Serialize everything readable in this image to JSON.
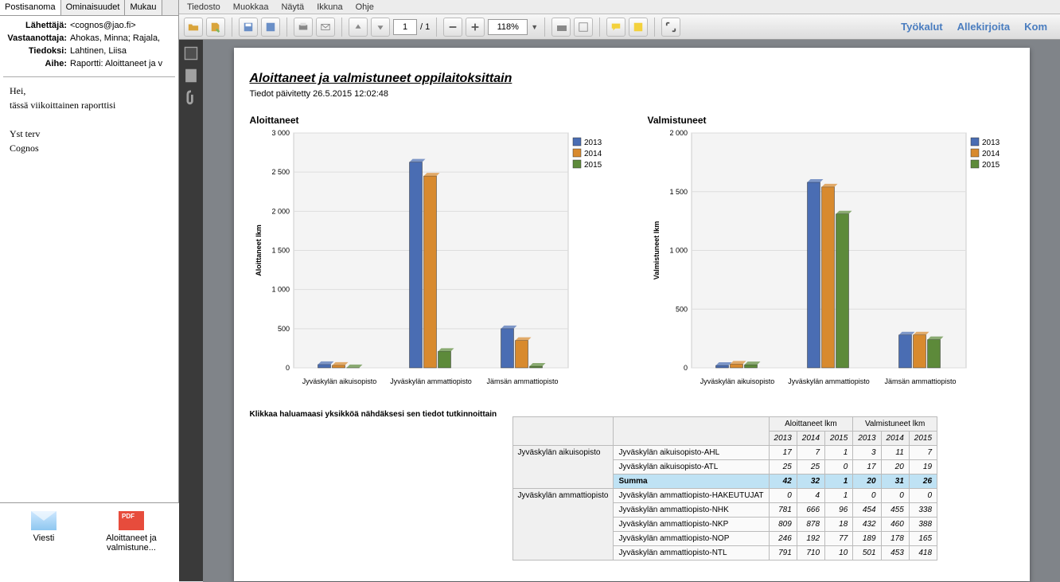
{
  "email": {
    "tabs": [
      "Postisanoma",
      "Ominaisuudet",
      "Mukau"
    ],
    "from_lbl": "Lähettäjä:",
    "from_val": "<cognos@jao.fi>",
    "to_lbl": "Vastaanottaja:",
    "to_val": "Ahokas, Minna; Rajala,",
    "cc_lbl": "Tiedoksi:",
    "cc_val": "Lahtinen, Liisa",
    "subj_lbl": "Aihe:",
    "subj_val": "Raportti: Aloittaneet ja v",
    "body_l1": "Hei,",
    "body_l2": "tässä viikoittainen raporttisi",
    "body_l3": "Yst terv",
    "body_l4": "Cognos",
    "att1": "Viesti",
    "att2": "Aloittaneet ja valmistune..."
  },
  "menubar": [
    "Tiedosto",
    "Muokkaa",
    "Näytä",
    "Ikkuna",
    "Ohje"
  ],
  "toolbar": {
    "page_cur": "1",
    "page_sep": "/ 1",
    "zoom": "118%",
    "right": [
      "Työkalut",
      "Allekirjoita",
      "Kom"
    ]
  },
  "report": {
    "title": "Aloittaneet ja valmistuneet oppilaitoksittain",
    "subtitle": "Tiedot päivitetty 26.5.2015 12:02:48",
    "legend": [
      "2013",
      "2014",
      "2015"
    ],
    "colors": [
      "#4a6db3",
      "#d88a2e",
      "#5d8a3a"
    ],
    "chart1_head": "Aloittaneet",
    "chart2_head": "Valmistuneet",
    "table_caption": "Klikkaa haluamaasi yksikköä nähdäksesi sen tiedot tutkinnoittain",
    "col_grp1": "Aloittaneet lkm",
    "col_grp2": "Valmistuneet lkm",
    "years": [
      "2013",
      "2014",
      "2015"
    ],
    "groups": [
      {
        "name": "Jyväskylän aikuisopisto",
        "rows": [
          {
            "name": "Jyväskylän aikuisopisto-AHL",
            "v": [
              17,
              7,
              1,
              3,
              11,
              7
            ]
          },
          {
            "name": "Jyväskylän aikuisopisto-ATL",
            "v": [
              25,
              25,
              0,
              17,
              20,
              19
            ]
          },
          {
            "name": "Summa",
            "v": [
              42,
              32,
              1,
              20,
              31,
              26
            ],
            "hl": true
          }
        ]
      },
      {
        "name": "Jyväskylän ammattiopisto",
        "rows": [
          {
            "name": "Jyväskylän ammattiopisto-HAKEUTUJAT",
            "v": [
              0,
              4,
              1,
              0,
              0,
              0
            ]
          },
          {
            "name": "Jyväskylän ammattiopisto-NHK",
            "v": [
              781,
              666,
              96,
              454,
              455,
              338
            ]
          },
          {
            "name": "Jyväskylän ammattiopisto-NKP",
            "v": [
              809,
              878,
              18,
              432,
              460,
              388
            ]
          },
          {
            "name": "Jyväskylän ammattiopisto-NOP",
            "v": [
              246,
              192,
              77,
              189,
              178,
              165
            ]
          },
          {
            "name": "Jyväskylän ammattiopisto-NTL",
            "v": [
              791,
              710,
              10,
              501,
              453,
              418
            ]
          }
        ]
      }
    ]
  },
  "chart_data": [
    {
      "type": "bar",
      "title": "Aloittaneet",
      "ylabel": "Aloittaneet lkm",
      "ylim": [
        0,
        3000
      ],
      "categories": [
        "Jyväskylän aikuisopisto",
        "Jyväskylän ammattiopisto",
        "Jämsän ammattiopisto"
      ],
      "series": [
        {
          "name": "2013",
          "values": [
            42,
            2627,
            500
          ]
        },
        {
          "name": "2014",
          "values": [
            32,
            2450,
            350
          ]
        },
        {
          "name": "2015",
          "values": [
            1,
            210,
            20
          ]
        }
      ]
    },
    {
      "type": "bar",
      "title": "Valmistuneet",
      "ylabel": "Valmistuneet lkm",
      "ylim": [
        0,
        2000
      ],
      "categories": [
        "Jyväskylän aikuisopisto",
        "Jyväskylän ammattiopisto",
        "Jämsän ammattiopisto"
      ],
      "series": [
        {
          "name": "2013",
          "values": [
            20,
            1580,
            280
          ]
        },
        {
          "name": "2014",
          "values": [
            31,
            1540,
            280
          ]
        },
        {
          "name": "2015",
          "values": [
            26,
            1310,
            240
          ]
        }
      ]
    }
  ]
}
